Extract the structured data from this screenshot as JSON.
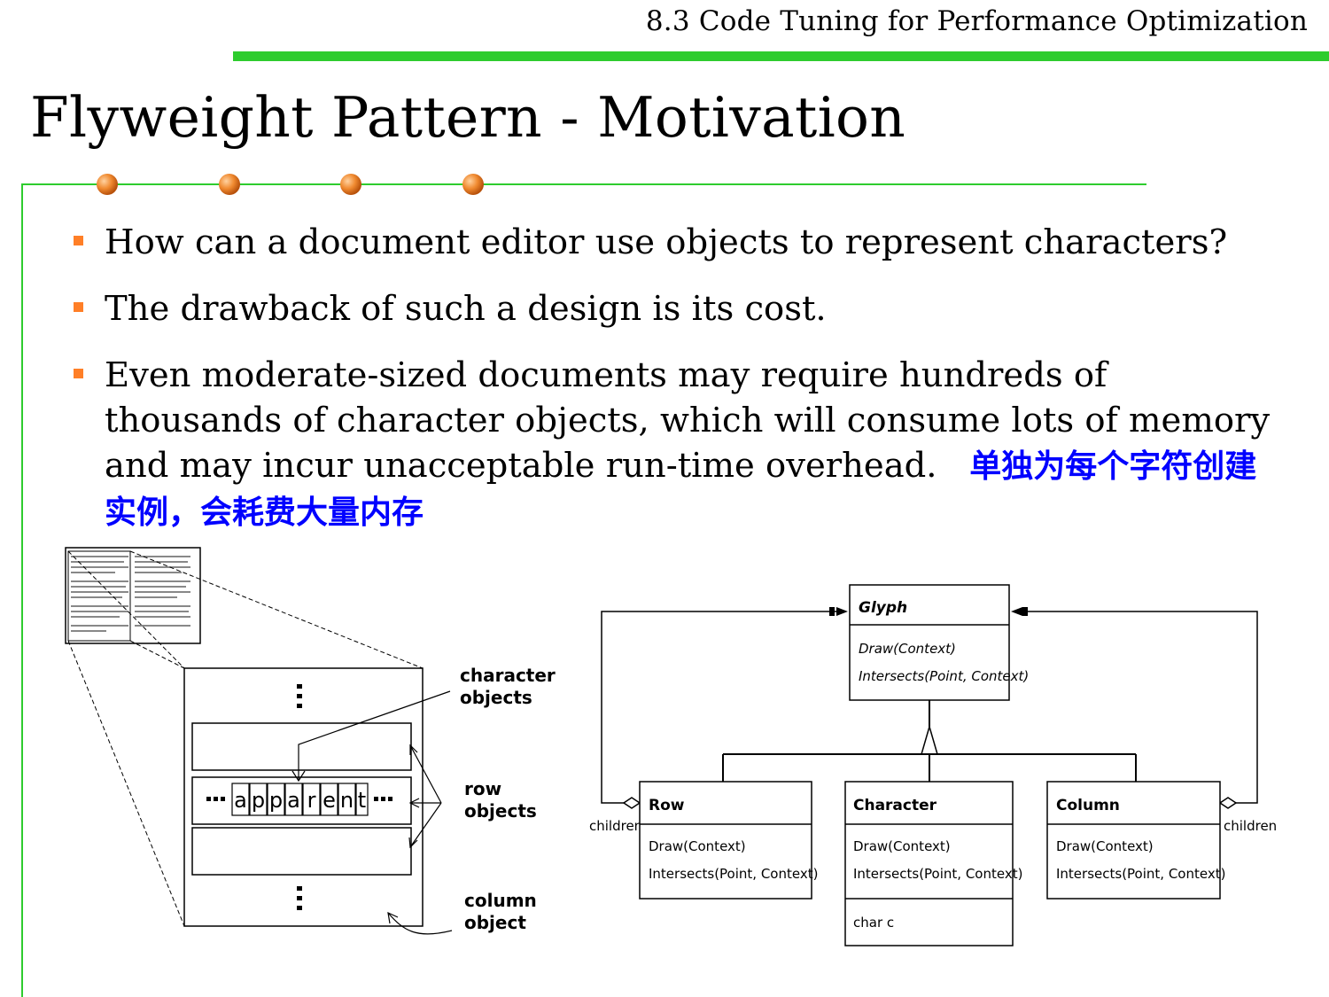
{
  "header": {
    "section_title": "8.3 Code Tuning for Performance Optimization"
  },
  "slide": {
    "title": "Flyweight Pattern - Motivation"
  },
  "bullets": [
    {
      "text": "How can a document editor use objects to represent characters?"
    },
    {
      "text": "The drawback of such a design is its cost."
    },
    {
      "text": "Even moderate-sized documents may require hundreds of thousands of character objects, which will consume lots of memory and may incur unacceptable run-time overhead.",
      "note": "单独为每个字符创建实例，会耗费大量内存"
    }
  ],
  "left_figure": {
    "letters": [
      "a",
      "p",
      "p",
      "a",
      "r",
      "e",
      "n",
      "t"
    ],
    "labels": {
      "character": "character\nobjects",
      "row": "row\nobjects",
      "column": "column\nobject"
    }
  },
  "uml": {
    "glyph": {
      "name": "Glyph",
      "ops": [
        "Draw(Context)",
        "Intersects(Point, Context)"
      ]
    },
    "row": {
      "name": "Row",
      "ops": [
        "Draw(Context)",
        "Intersects(Point, Context)"
      ]
    },
    "character": {
      "name": "Character",
      "ops": [
        "Draw(Context)",
        "Intersects(Point, Context)"
      ],
      "attrs": [
        "char c"
      ]
    },
    "column": {
      "name": "Column",
      "ops": [
        "Draw(Context)",
        "Intersects(Point, Context)"
      ]
    },
    "children_left": "children",
    "children_right": "children"
  },
  "colors": {
    "rule": "#2ecc2e",
    "bullet": "#ff7f27",
    "dot": "#e8701e",
    "note": "#0000ff"
  }
}
